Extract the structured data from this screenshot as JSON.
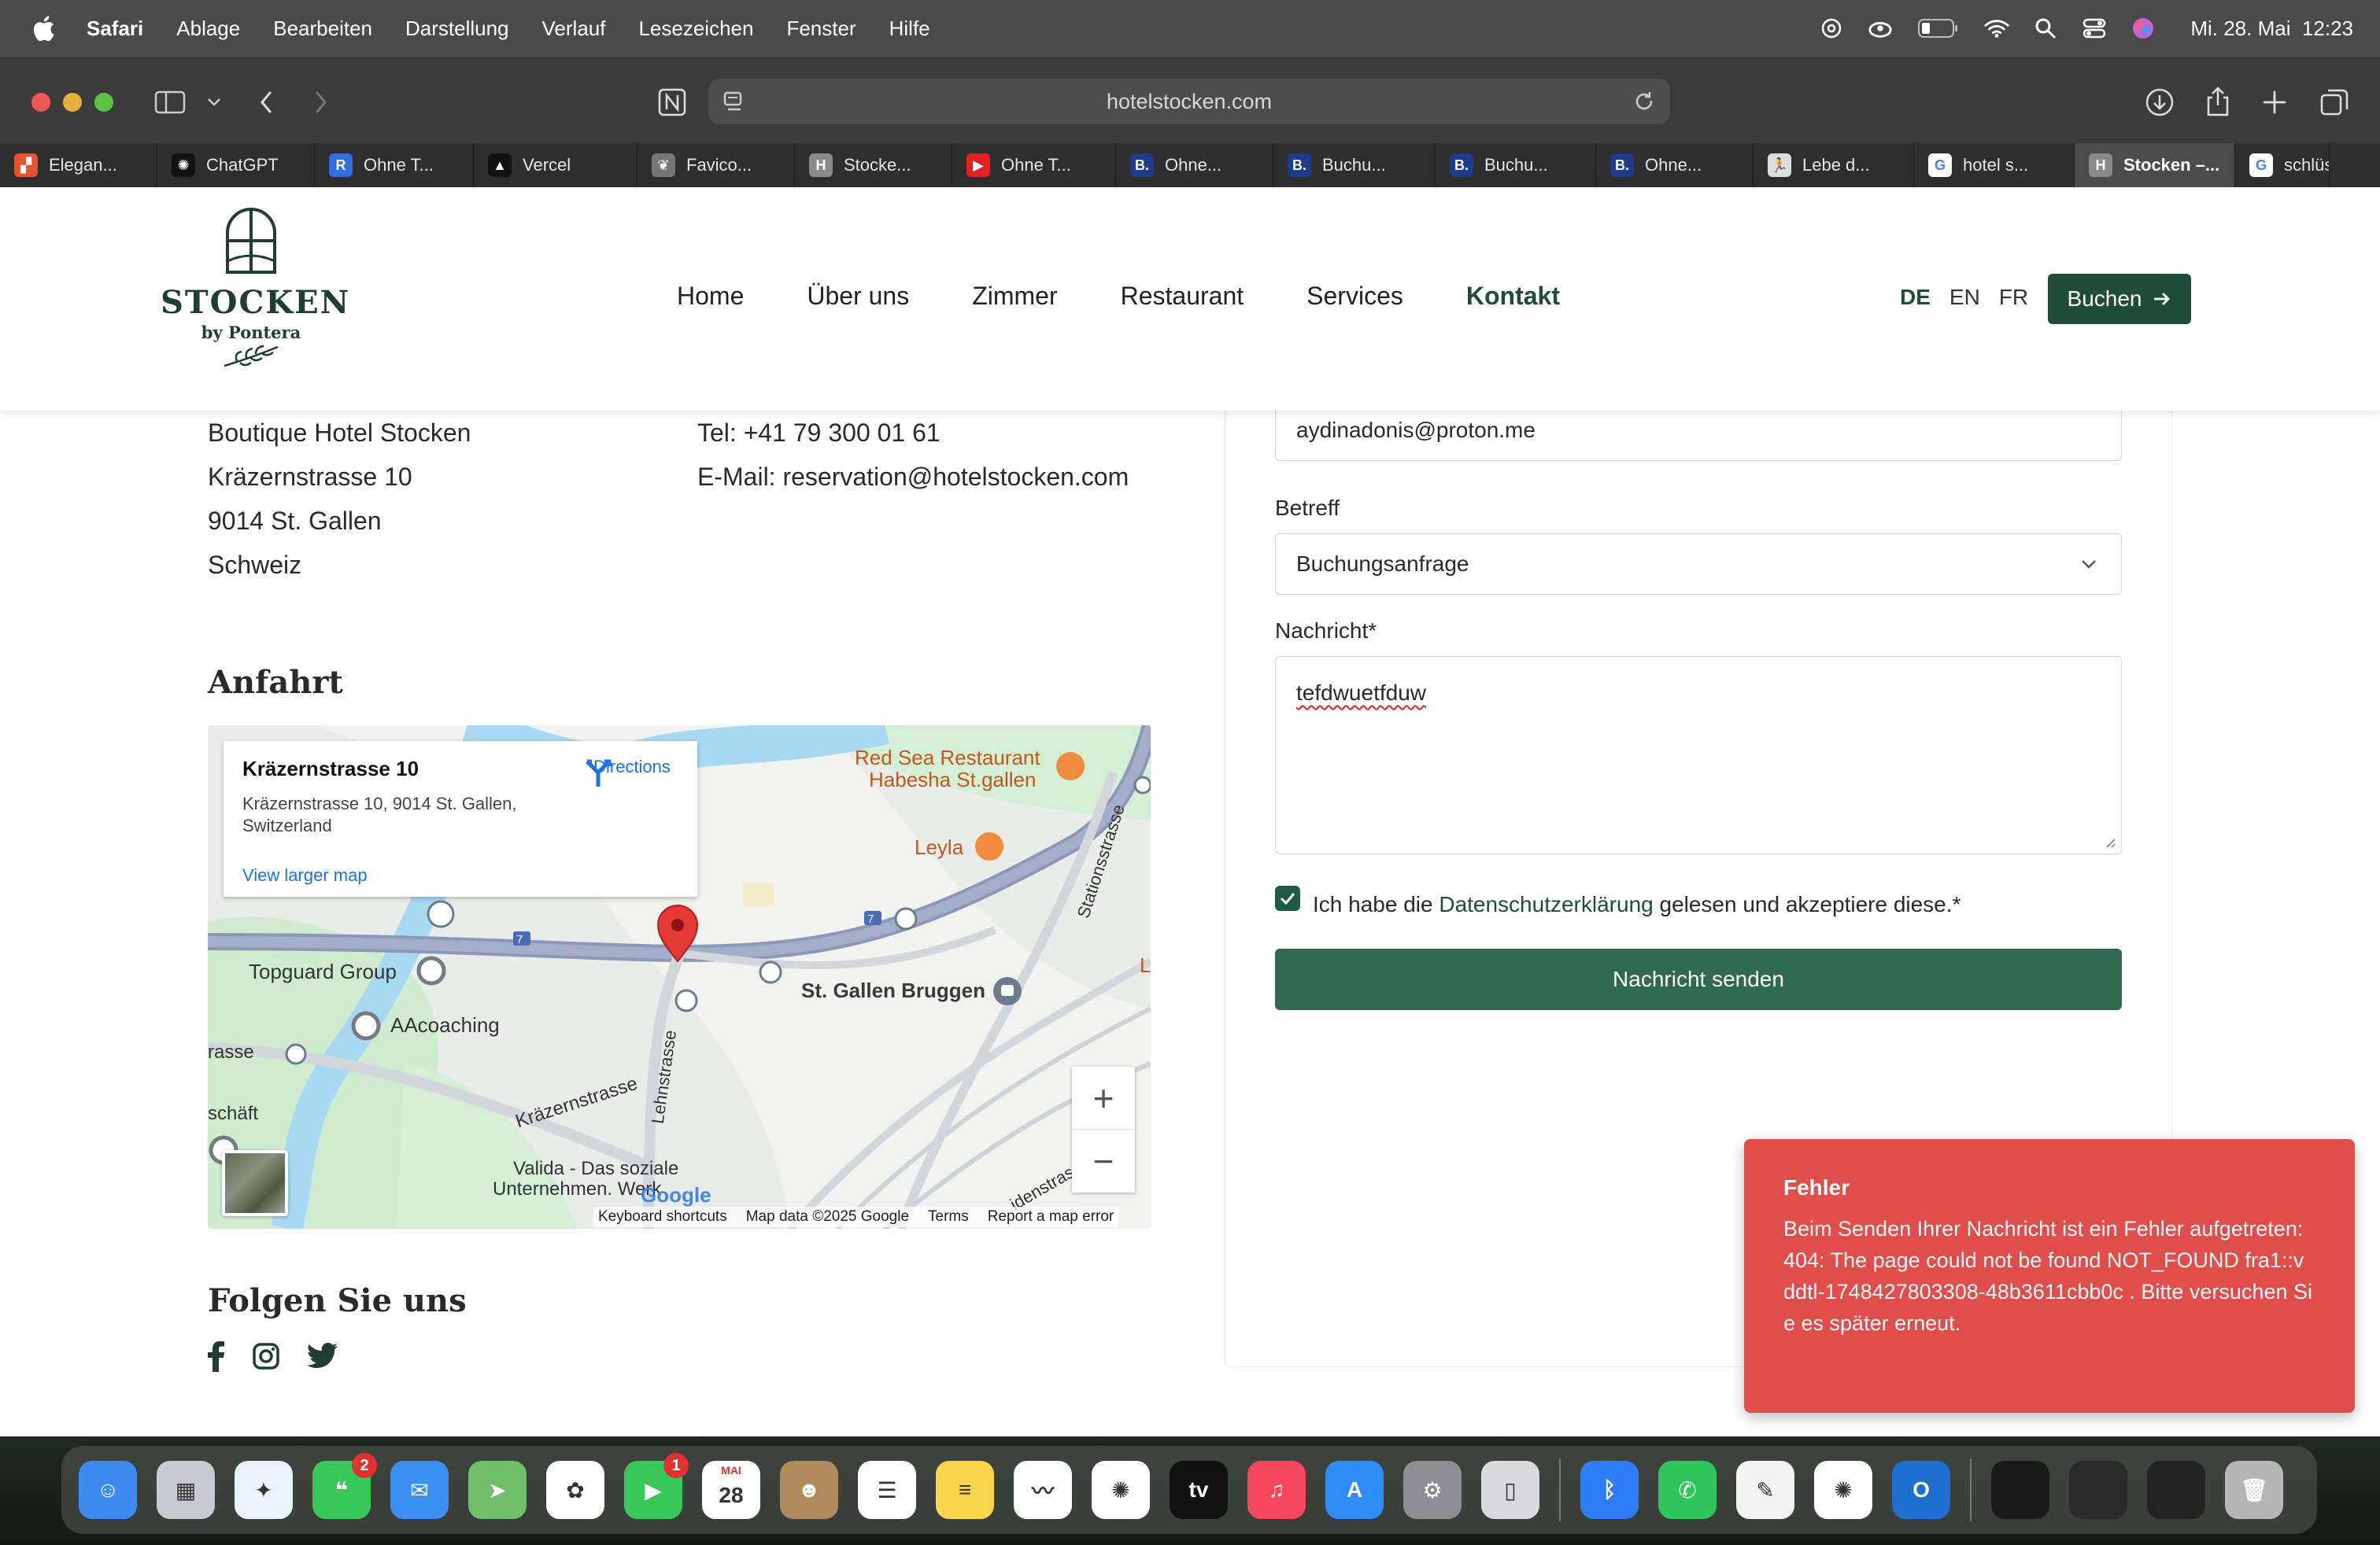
{
  "menubar": {
    "app": "Safari",
    "items": [
      "Ablage",
      "Bearbeiten",
      "Darstellung",
      "Verlauf",
      "Lesezeichen",
      "Fenster",
      "Hilfe"
    ],
    "datetime": "Mi. 28. Mai  12:23"
  },
  "browser": {
    "url": "hotelstocken.com",
    "tabs": [
      {
        "label": "Elegan...",
        "icon": "elegant-icon",
        "color": "#e8552a",
        "glyph": "▞"
      },
      {
        "label": "ChatGPT",
        "icon": "chatgpt-icon",
        "color": "#111111",
        "glyph": "✺"
      },
      {
        "label": "Ohne T...",
        "icon": "r-icon",
        "color": "#2f6fe0",
        "glyph": "R"
      },
      {
        "label": "Vercel",
        "icon": "vercel-icon",
        "color": "#111111",
        "glyph": "▲"
      },
      {
        "label": "Favico...",
        "icon": "favicon-icon",
        "color": "#777777",
        "glyph": "❦"
      },
      {
        "label": "Stocke...",
        "icon": "stocken-h-icon",
        "color": "#8a8a8a",
        "glyph": "H"
      },
      {
        "label": "Ohne T...",
        "icon": "youtube-icon",
        "color": "#e22020",
        "glyph": "▶"
      },
      {
        "label": "Ohne...",
        "icon": "booking-icon",
        "color": "#1e3a8a",
        "glyph": "B."
      },
      {
        "label": "Buchu...",
        "icon": "booking-icon",
        "color": "#1e3a8a",
        "glyph": "B."
      },
      {
        "label": "Buchu...",
        "icon": "booking-icon",
        "color": "#1e3a8a",
        "glyph": "B."
      },
      {
        "label": "Ohne...",
        "icon": "booking-icon",
        "color": "#1e3a8a",
        "glyph": "B."
      },
      {
        "label": "Lebe d...",
        "icon": "runner-icon",
        "color": "#dddddd",
        "glyph": "🏃"
      },
      {
        "label": "hotel s...",
        "icon": "google-icon",
        "color": "#ffffff",
        "glyph": "G"
      },
      {
        "label": "Stocken –...",
        "icon": "stocken-h-icon",
        "color": "#8a8a8a",
        "glyph": "H",
        "active": true
      },
      {
        "label": "schlüs...",
        "icon": "google-icon",
        "color": "#ffffff",
        "glyph": "G"
      }
    ]
  },
  "site": {
    "logo": {
      "name": "STOCKEN",
      "sub": "by Pontera"
    },
    "nav": [
      "Home",
      "Über uns",
      "Zimmer",
      "Restaurant",
      "Services",
      "Kontakt"
    ],
    "nav_active": "Kontakt",
    "langs": [
      "DE",
      "EN",
      "FR"
    ],
    "lang_active": "DE",
    "book_label": "Buchen",
    "brand_color": "#1f4d3a"
  },
  "address": {
    "lines": [
      "Boutique Hotel Stocken",
      "Kräzernstrasse 10",
      "9014 St. Gallen",
      "Schweiz"
    ],
    "phone": "Tel: +41 79 300 01 61",
    "email": "E-Mail: reservation@hotelstocken.com"
  },
  "directions": {
    "heading": "Anfahrt",
    "map": {
      "place_title": "Kräzernstrasse 10",
      "place_address": "Kräzernstrasse 10, 9014 St. Gallen, Switzerland",
      "directions_label": "Directions",
      "larger_map_label": "View larger map",
      "labels": {
        "red_sea": "Red Sea Restaurant",
        "habesha": "Habesha St.gallen",
        "leyla": "Leyla",
        "topguard": "Topguard Group",
        "aacoaching": "AAcoaching",
        "bruggen": "St. Gallen Bruggen",
        "krazern": "Kräzernstrasse",
        "lehn": "Lehnstrasse",
        "station": "Stationsstrasse",
        "valida": "Valida - Das soziale",
        "unternehmen": "Unternehmen. Werk",
        "strasse_left": "rasse",
        "geschaeft": "schäft",
        "weiden": "idenstrasse",
        "l_cut": "L",
        "road7": "7"
      },
      "attribution": [
        "Keyboard shortcuts",
        "Map data ©2025 Google",
        "Terms",
        "Report a map error"
      ],
      "google": "Google"
    }
  },
  "social": {
    "heading": "Folgen Sie uns",
    "icons": [
      "facebook-icon",
      "instagram-icon",
      "twitter-icon"
    ]
  },
  "form": {
    "email_value": "aydinadonis@proton.me",
    "subject_label": "Betreff",
    "subject_value": "Buchungsanfrage",
    "message_label": "Nachricht*",
    "message_value": "tefdwuetfduw",
    "consent_checked": true,
    "consent_prefix": "Ich habe die ",
    "consent_link": "Datenschutzerklärung",
    "consent_suffix": " gelesen und akzeptiere diese.*",
    "submit_label": "Nachricht senden"
  },
  "toast": {
    "title": "Fehler",
    "message": "Beim Senden Ihrer Nachricht ist ein Fehler aufgetreten: 404: The page could not be found NOT_FOUND fra1::vddtl-1748427803308-48b3611cbb0c . Bitte versuchen Sie es später erneut.",
    "color": "#e04e4b"
  },
  "dock": {
    "apps": [
      {
        "name": "finder",
        "color": "#3d8bf0",
        "glyph": "☺"
      },
      {
        "name": "launchpad",
        "color": "#c9c9d1",
        "glyph": "▦"
      },
      {
        "name": "safari",
        "color": "#e9f1fb",
        "glyph": "✦"
      },
      {
        "name": "messages",
        "color": "#38c759",
        "glyph": "❝",
        "badge": "2"
      },
      {
        "name": "mail",
        "color": "#3b8ff2",
        "glyph": "✉"
      },
      {
        "name": "maps",
        "color": "#6fbf6b",
        "glyph": "➤"
      },
      {
        "name": "photos",
        "color": "#ffffff",
        "glyph": "✿"
      },
      {
        "name": "facetime",
        "color": "#38c759",
        "glyph": "▶",
        "badge": "1"
      },
      {
        "name": "calendar",
        "color": "#ffffff",
        "glyph": "28",
        "top": "MAI"
      },
      {
        "name": "contacts",
        "color": "#b08a5a",
        "glyph": "☻"
      },
      {
        "name": "reminders",
        "color": "#ffffff",
        "glyph": "☰"
      },
      {
        "name": "notes",
        "color": "#f8d54a",
        "glyph": "≡"
      },
      {
        "name": "freeform",
        "color": "#ffffff",
        "glyph": "〰"
      },
      {
        "name": "chatgpt",
        "color": "#ffffff",
        "glyph": "✺"
      },
      {
        "name": "appletv",
        "color": "#111111",
        "glyph": "tv"
      },
      {
        "name": "music",
        "color": "#f5475c",
        "glyph": "♫"
      },
      {
        "name": "appstore",
        "color": "#2f8df5",
        "glyph": "A"
      },
      {
        "name": "settings",
        "color": "#8d8d93",
        "glyph": "⚙"
      },
      {
        "name": "iphone-mirroring",
        "color": "#d9d9de",
        "glyph": "▯"
      },
      {
        "name": "sep",
        "color": "",
        "glyph": ""
      },
      {
        "name": "bluetooth",
        "color": "#2f7df5",
        "glyph": "ᛒ"
      },
      {
        "name": "whatsapp",
        "color": "#2fc55a",
        "glyph": "✆"
      },
      {
        "name": "textedit",
        "color": "#f4f4f4",
        "glyph": "✎"
      },
      {
        "name": "chatgpt-2",
        "color": "#ffffff",
        "glyph": "✺"
      },
      {
        "name": "outlook",
        "color": "#1f6fd1",
        "glyph": "O"
      },
      {
        "name": "sep",
        "color": "",
        "glyph": ""
      },
      {
        "name": "window-1",
        "color": "#1a1a1a",
        "glyph": ""
      },
      {
        "name": "window-2",
        "color": "#2a2a2a",
        "glyph": ""
      },
      {
        "name": "window-3",
        "color": "#222222",
        "glyph": ""
      },
      {
        "name": "trash",
        "color": "#b6b6b6",
        "glyph": "🗑"
      }
    ]
  }
}
